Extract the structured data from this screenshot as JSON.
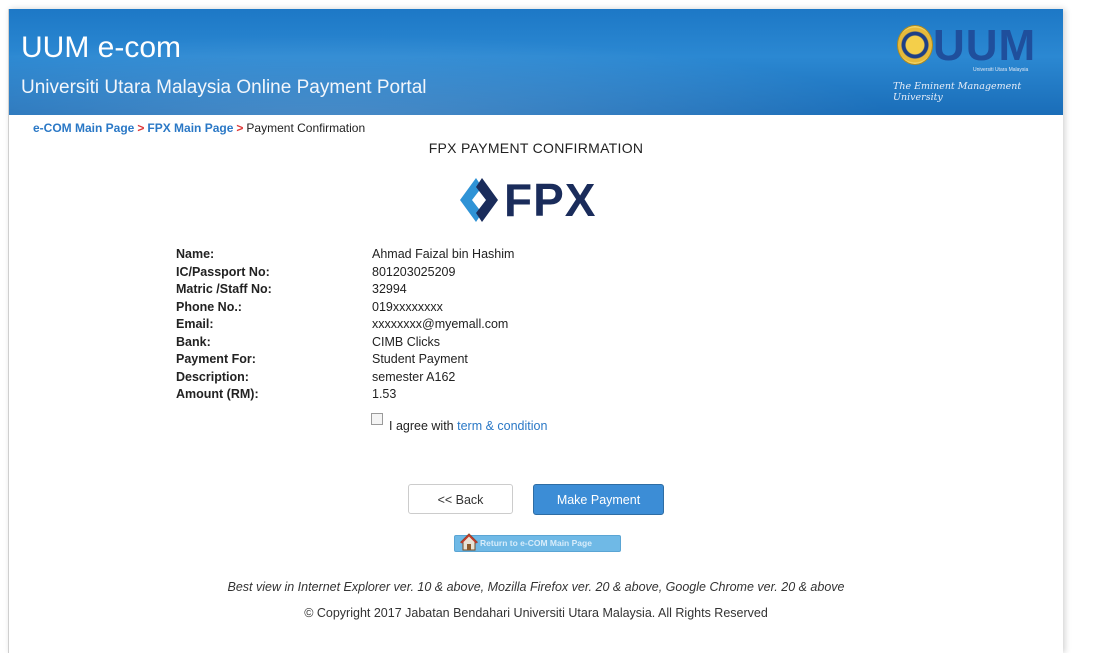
{
  "header": {
    "title": "UUM e-com",
    "subtitle": "Universiti Utara Malaysia Online Payment Portal",
    "logo_letters": "UUM",
    "logo_small": "Universiti Utara Malaysia",
    "logo_tagline": "The Eminent Management University",
    "colors": {
      "bar": "#2b88d2",
      "logo_text": "#1f4f9c"
    }
  },
  "breadcrumb": {
    "items": [
      "e-COM Main Page",
      "FPX Main Page"
    ],
    "separator": ">",
    "current": "Payment Confirmation"
  },
  "page_title": "FPX PAYMENT CONFIRMATION",
  "fpx_logo": {
    "text": "FPX",
    "icon": "fpx-chevrons-icon"
  },
  "details": [
    {
      "label": "Name:",
      "value": "Ahmad Faizal bin Hashim"
    },
    {
      "label": "IC/Passport No:",
      "value": "801203025209"
    },
    {
      "label": "Matric /Staff No:",
      "value": "32994"
    },
    {
      "label": "Phone No.:",
      "value": "019xxxxxxxx"
    },
    {
      "label": "Email:",
      "value": "xxxxxxxx@myemall.com"
    },
    {
      "label": "Bank:",
      "value": "CIMB Clicks"
    },
    {
      "label": "Payment For:",
      "value": "Student Payment"
    },
    {
      "label": "Description:",
      "value": "semester A162"
    },
    {
      "label": "Amount (RM):",
      "value": "1.53"
    }
  ],
  "agreement": {
    "text": "I agree with",
    "link": "term & condition",
    "checked": false
  },
  "buttons": {
    "back": "<< Back",
    "pay": "Make Payment",
    "return": "Return to e-COM Main Page"
  },
  "footer": {
    "best_view": "Best view in Internet Explorer ver. 10 & above, Mozilla Firefox ver. 20 & above, Google Chrome ver. 20 & above",
    "copyright": "© Copyright 2017 Jabatan Bendahari Universiti Utara Malaysia. All Rights Reserved"
  }
}
